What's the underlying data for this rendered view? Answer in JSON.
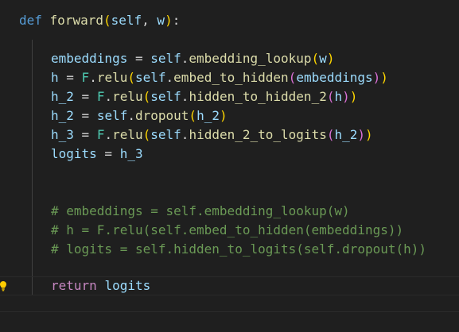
{
  "editor": {
    "language": "python",
    "colors": {
      "background": "#1f1f1f",
      "keyword": "#569cd6",
      "control_keyword": "#c586c0",
      "function": "#dcdcaa",
      "variable": "#9cdcfe",
      "comment": "#6a9955",
      "bracket_level_1": "#ffd700",
      "bracket_level_2": "#da70d6",
      "bracket_level_3": "#179fff"
    },
    "lines": {
      "def": {
        "kw": "def",
        "sp1": " ",
        "name": "forward",
        "open": "(",
        "self": "self",
        "comma": ", ",
        "w": "w",
        "close": ")",
        "colon": ":"
      },
      "l1": {
        "var": "embeddings",
        "eq": " = ",
        "self": "self",
        "dot": ".",
        "fn": "embedding_lookup",
        "open": "(",
        "arg": "w",
        "close": ")"
      },
      "l2": {
        "var": "h",
        "eq": " = ",
        "mod": "F",
        "dot": ".",
        "fn": "relu",
        "open1": "(",
        "self": "self",
        "dot2": ".",
        "fn2": "embed_to_hidden",
        "open2": "(",
        "arg": "embeddings",
        "close2": ")",
        "close1": ")"
      },
      "l3": {
        "var": "h_2",
        "eq": " = ",
        "mod": "F",
        "dot": ".",
        "fn": "relu",
        "open1": "(",
        "self": "self",
        "dot2": ".",
        "fn2": "hidden_to_hidden_2",
        "open2": "(",
        "arg": "h",
        "close2": ")",
        "close1": ")"
      },
      "l4": {
        "var": "h_2",
        "eq": " = ",
        "self": "self",
        "dot": ".",
        "fn": "dropout",
        "open": "(",
        "arg": "h_2",
        "close": ")"
      },
      "l5": {
        "var": "h_3",
        "eq": " = ",
        "mod": "F",
        "dot": ".",
        "fn": "relu",
        "open1": "(",
        "self": "self",
        "dot2": ".",
        "fn2": "hidden_2_to_logits",
        "open2": "(",
        "arg": "h_2",
        "close2": ")",
        "close1": ")"
      },
      "l6": {
        "var": "logits",
        "eq": " = ",
        "arg": "h_3"
      },
      "c1": "# embeddings = self.embedding_lookup(w)",
      "c2": "# h = F.relu(self.embed_to_hidden(embeddings))",
      "c3": "# logits = self.hidden_to_logits(self.dropout(h))",
      "ret": {
        "kw": "return",
        "sp": " ",
        "var": "logits"
      }
    }
  }
}
